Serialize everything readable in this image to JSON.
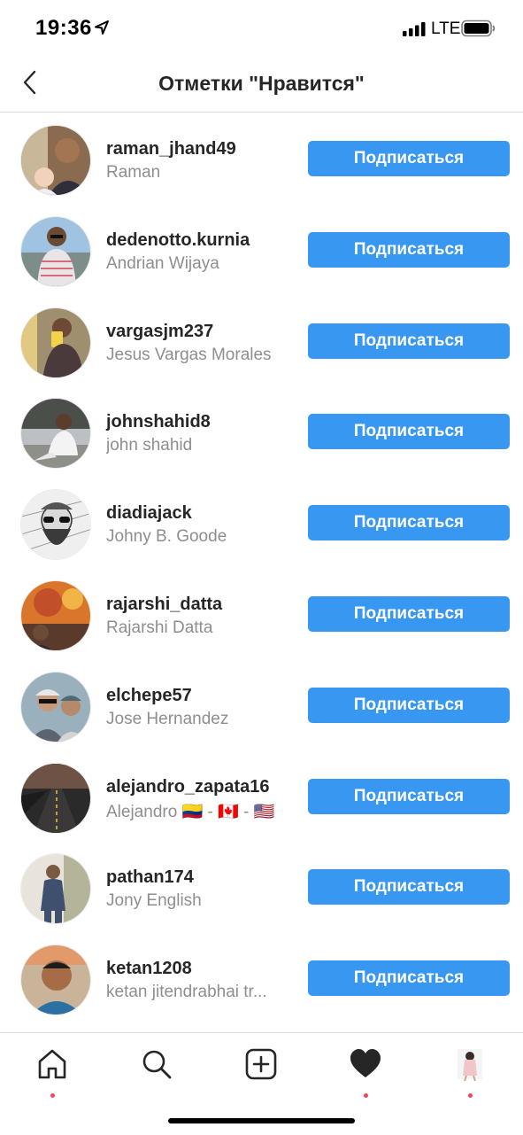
{
  "status_bar": {
    "time": "19:36",
    "network": "LTE"
  },
  "header": {
    "title": "Отметки \"Нравится\"",
    "back_icon": "chevron-left-icon"
  },
  "likes": [
    {
      "username": "raman_jhand49",
      "fullname": "Raman",
      "button": "Подписаться"
    },
    {
      "username": "dedenotto.kurnia",
      "fullname": "Andrian Wijaya",
      "button": "Подписаться"
    },
    {
      "username": "vargasjm237",
      "fullname": "Jesus Vargas Morales",
      "button": "Подписаться"
    },
    {
      "username": "johnshahid8",
      "fullname": "john shahid",
      "button": "Подписаться"
    },
    {
      "username": "diadiajack",
      "fullname": "Johny B. Goode",
      "button": "Подписаться"
    },
    {
      "username": "rajarshi_datta",
      "fullname": "Rajarshi Datta",
      "button": "Подписаться"
    },
    {
      "username": "elchepe57",
      "fullname": "Jose Hernandez",
      "button": "Подписаться"
    },
    {
      "username": "alejandro_zapata16",
      "fullname": "Alejandro 🇨🇴 - 🇨🇦 - 🇺🇸",
      "button": "Подписаться"
    },
    {
      "username": "pathan174",
      "fullname": "Jony English",
      "button": "Подписаться"
    },
    {
      "username": "ketan1208",
      "fullname": "ketan jitendrabhai tr...",
      "button": "Подписаться"
    }
  ],
  "tab_bar": {
    "items": [
      "home-icon",
      "search-icon",
      "add-post-icon",
      "heart-icon",
      "profile-avatar"
    ]
  },
  "colors": {
    "accent": "#3897f0",
    "notification_dot": "#ed4956",
    "secondary_text": "#8e8e8e"
  }
}
